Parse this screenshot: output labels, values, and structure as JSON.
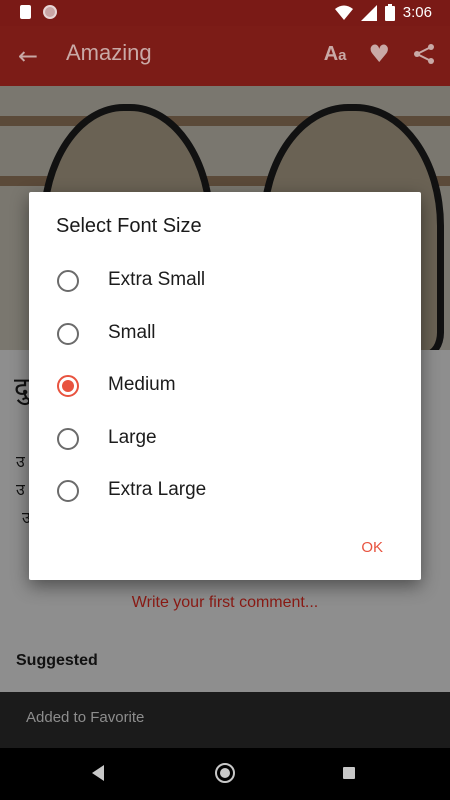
{
  "statusbar": {
    "time": "3:06"
  },
  "appbar": {
    "title": "Amazing",
    "back_icon": "arrow-left-icon",
    "font_icon_main": "A",
    "font_icon_small": "a"
  },
  "content": {
    "heading_glyph": "दु",
    "lines": [
      "उ",
      "उ",
      "उ"
    ],
    "comment_link": "Write your first comment...",
    "suggested": "Suggested"
  },
  "snackbar": {
    "message": "Added to Favorite"
  },
  "dialog": {
    "title": "Select Font Size",
    "options": [
      {
        "label": "Extra Small",
        "selected": false
      },
      {
        "label": "Small",
        "selected": false
      },
      {
        "label": "Medium",
        "selected": true
      },
      {
        "label": "Large",
        "selected": false
      },
      {
        "label": "Extra Large",
        "selected": false
      }
    ],
    "ok_label": "OK",
    "accent_color": "#e8533f"
  }
}
